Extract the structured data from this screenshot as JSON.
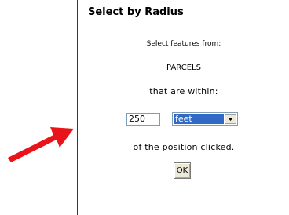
{
  "dialog": {
    "title": "Select by Radius",
    "intro": "Select features from:",
    "layer": "PARCELS",
    "within_label": "that are within:",
    "distance_value": "250",
    "unit_selected": "feet",
    "suffix_label": "of the position clicked.",
    "ok_label": "OK"
  },
  "colors": {
    "arrow": "#e8141a",
    "selection_highlight": "#316ac5",
    "panel_border": "#3a3a3a"
  }
}
